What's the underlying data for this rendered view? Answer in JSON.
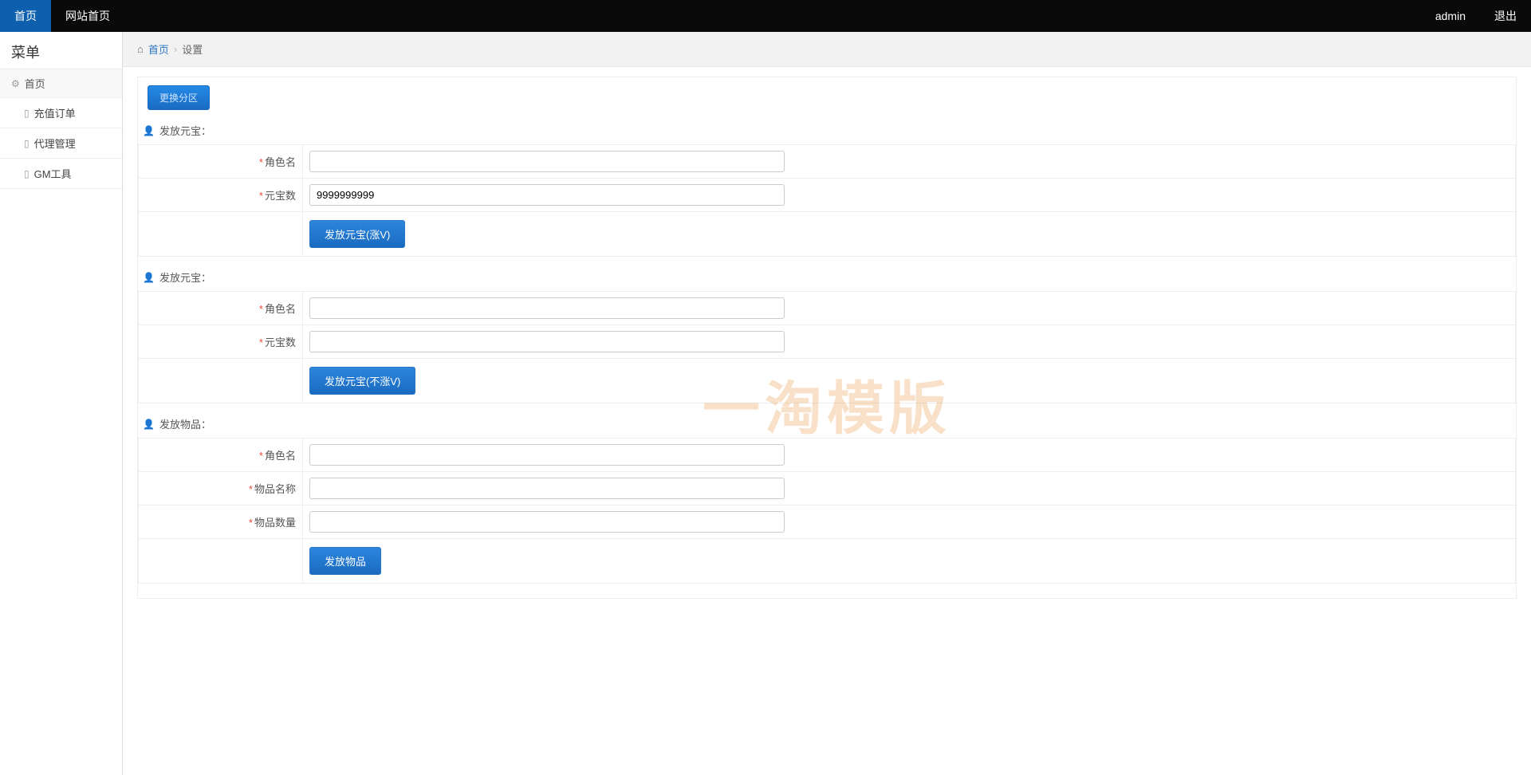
{
  "topbar": {
    "home": "首页",
    "site_home": "网站首页",
    "user": "admin",
    "logout": "退出"
  },
  "sidebar": {
    "title": "菜单",
    "parent": "首页",
    "items": [
      {
        "label": "充值订单"
      },
      {
        "label": "代理管理"
      },
      {
        "label": "GM工具"
      }
    ]
  },
  "breadcrumb": {
    "home": "首页",
    "current": "设置"
  },
  "switch_button": "更换分区",
  "sections": {
    "s1": {
      "title": "发放元宝：",
      "role_label": "角色名",
      "role_value": "",
      "amount_label": "元宝数",
      "amount_value": "9999999999",
      "submit": "发放元宝(涨V)"
    },
    "s2": {
      "title": "发放元宝：",
      "role_label": "角色名",
      "role_value": "",
      "amount_label": "元宝数",
      "amount_value": "",
      "submit": "发放元宝(不涨V)"
    },
    "s3": {
      "title": "发放物品：",
      "role_label": "角色名",
      "role_value": "",
      "item_label": "物品名称",
      "item_value": "",
      "qty_label": "物品数量",
      "qty_value": "",
      "submit": "发放物品"
    }
  },
  "watermark": "一淘模版"
}
